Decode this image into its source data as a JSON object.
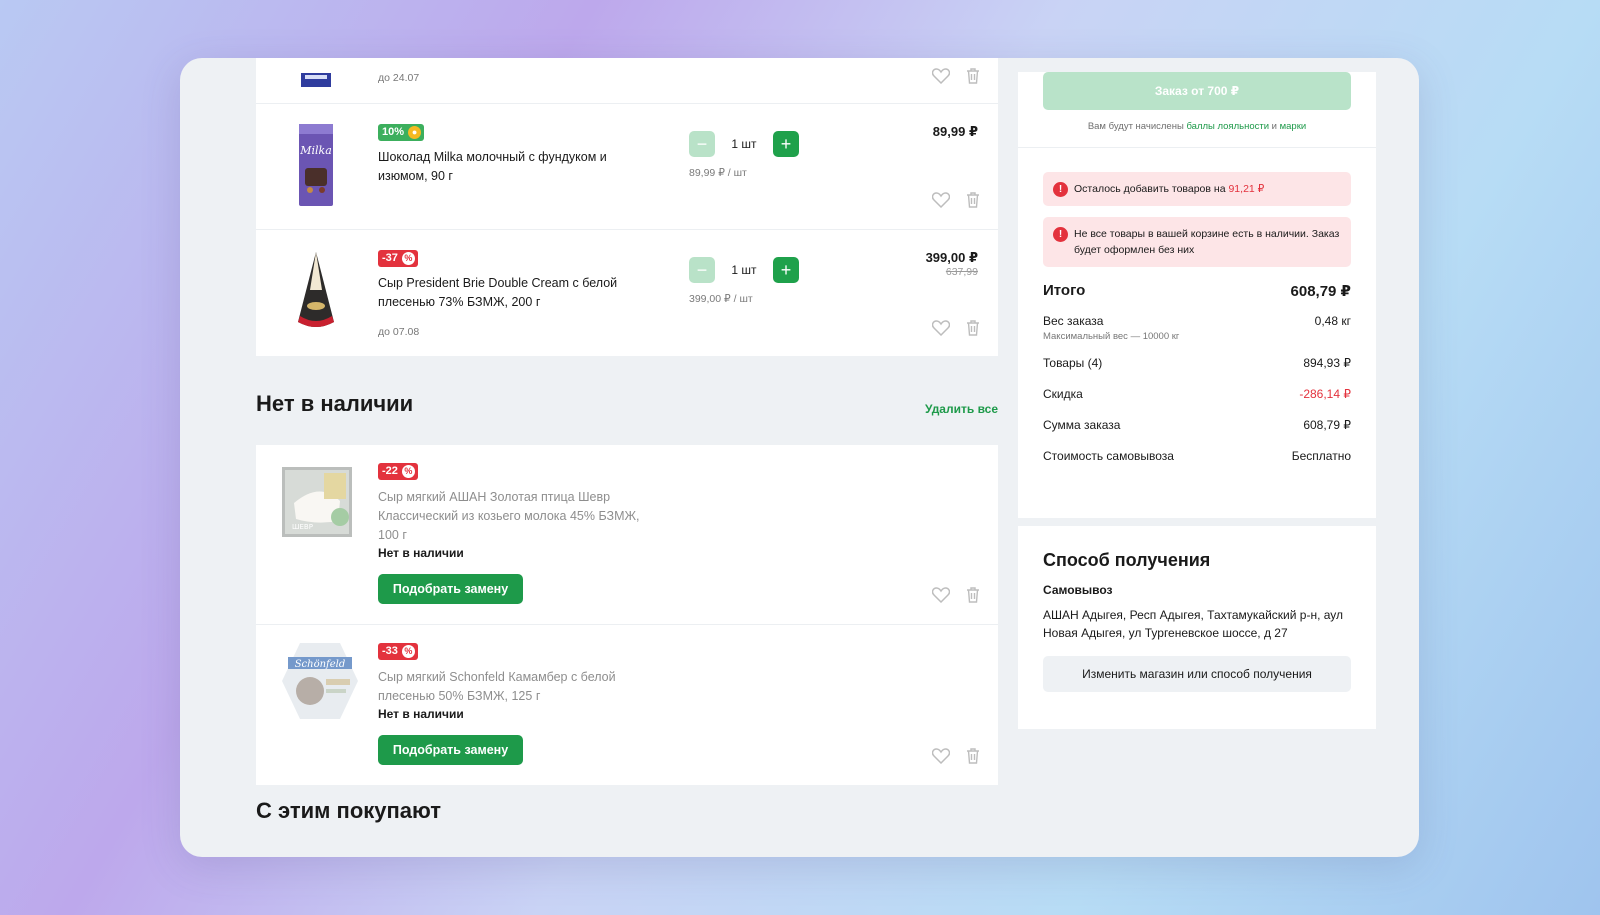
{
  "cart": {
    "items": [
      {
        "date": "до 24.07"
      },
      {
        "badge": "10%",
        "name": "Шоколад Milka молочный с фундуком и изюмом, 90 г",
        "qty": "1 шт",
        "unit_price": "89,99 ₽ / шт",
        "price": "89,99 ₽"
      },
      {
        "badge": "-37",
        "name": "Сыр President Brie Double Cream с белой плесенью 73% БЗМЖ, 200 г",
        "date": "до 07.08",
        "qty": "1 шт",
        "unit_price": "399,00 ₽ / шт",
        "price": "399,00 ₽",
        "old_price": "637,99"
      }
    ]
  },
  "unavailable": {
    "title": "Нет в наличии",
    "delete_all": "Удалить все",
    "items": [
      {
        "badge": "-22",
        "name": "Сыр мягкий АШАН Золотая птица Шевр Классический из козьего молока 45% БЗМЖ, 100 г",
        "status": "Нет в наличии",
        "button": "Подобрать замену"
      },
      {
        "badge": "-33",
        "name": "Сыр мягкий Schonfeld Камамбер с белой плесенью 50% БЗМЖ, 125 г",
        "status": "Нет в наличии",
        "button": "Подобрать замену"
      }
    ]
  },
  "also_bought": {
    "title": "С этим покупают"
  },
  "summary": {
    "order_button": "Заказ от 700 ₽",
    "loyalty_prefix": "Вам будут начислены",
    "loyalty_link1": "баллы лояльности",
    "loyalty_and": "и",
    "loyalty_link2": "марки",
    "alert1_text": "Осталось добавить товаров на",
    "alert1_amount": "91,21 ₽",
    "alert2_text": "Не все товары в вашей корзине есть в наличии. Заказ будет оформлен без них",
    "total_label": "Итого",
    "total_value": "608,79 ₽",
    "weight_label": "Вес заказа",
    "weight_value": "0,48 кг",
    "weight_max": "Максимальный вес — 10000 кг",
    "goods_label": "Товары (4)",
    "goods_value": "894,93 ₽",
    "discount_label": "Скидка",
    "discount_value": "-286,14 ₽",
    "sum_label": "Сумма заказа",
    "sum_value": "608,79 ₽",
    "pickup_cost_label": "Стоимость самовывоза",
    "pickup_cost_value": "Бесплатно"
  },
  "delivery": {
    "title": "Способ получения",
    "method": "Самовывоз",
    "address": "АШАН Адыгея, Респ Адыгея, Тахтамукайский р-н, аул Новая Адыгея, ул Тургеневское шоссе, д 27",
    "change_button": "Изменить магазин или способ получения"
  },
  "colors": {
    "accent_green": "#1e9a4a",
    "discount_red": "#e3323d",
    "disabled_green": "#b9e3c9"
  },
  "icons": [
    "heart-icon",
    "trash-icon",
    "info-icon",
    "plus-icon",
    "minus-icon"
  ]
}
